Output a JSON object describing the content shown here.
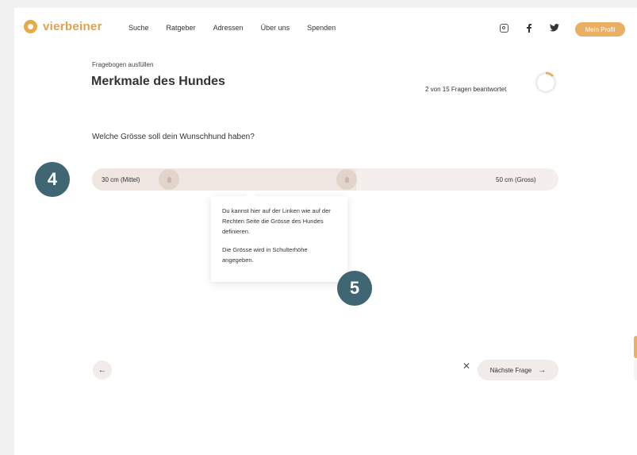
{
  "header": {
    "logo_text": "vierbeiner",
    "nav": [
      "Suche",
      "Ratgeber",
      "Adressen",
      "Über uns",
      "Spenden"
    ],
    "social_icons": [
      "instagram-icon",
      "facebook-icon",
      "twitter-icon"
    ],
    "profile_label": "Mein Profil",
    "accent_color": "#e9b064"
  },
  "questionnaire": {
    "subtitle": "Fragebogen ausfüllen",
    "title": "Merkmale des Hundes",
    "progress_text": "2 von 15 Fragen beantwortet",
    "progress_fraction": 0.133,
    "question": "Welche Grösse soll dein Wunschhund haben?"
  },
  "slider": {
    "min_label": "30 cm (Mittel)",
    "max_label": "50 cm (Gross)"
  },
  "tooltip": {
    "line1": "Du kannst hier auf der Linken wie auf der Rechten Seite die Grösse des Hundes definieren.",
    "line2": "Die Grösse wird in Schulterhöhe angegeben."
  },
  "steps": {
    "step_a": "4",
    "step_b": "5",
    "badge_color": "#3f6672"
  },
  "footer": {
    "back_icon": "←",
    "close_icon": "✕",
    "next_label": "Nächste Frage",
    "next_arrow": "→"
  }
}
